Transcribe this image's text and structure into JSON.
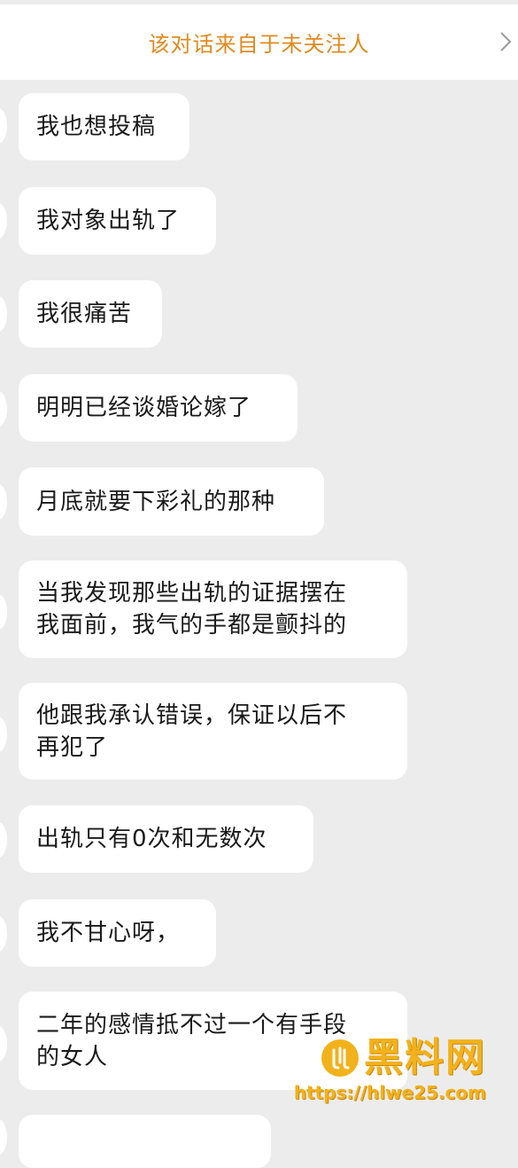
{
  "header": {
    "banner_text": "该对话来自于未关注人",
    "chevron_icon": "chevron-right-icon"
  },
  "messages": [
    "我也想投稿",
    "我对象出轨了",
    "我很痛苦",
    "明明已经谈婚论嫁了",
    "月底就要下彩礼的那种",
    "当我发现那些出轨的证据摆在\n我面前，我气的手都是颤抖的",
    "他跟我承认错误，保证以后不\n再犯了",
    "出轨只有0次和无数次",
    "我不甘心呀，",
    "二年的感情抵不过一个有手段\n的女人",
    ""
  ],
  "watermark": {
    "title": "黑料网",
    "url": "https://hlwe25.com"
  },
  "colors": {
    "banner_text": "#e08a1e",
    "background": "#ececec",
    "bubble": "#ffffff",
    "watermark": "#f2b21b"
  }
}
